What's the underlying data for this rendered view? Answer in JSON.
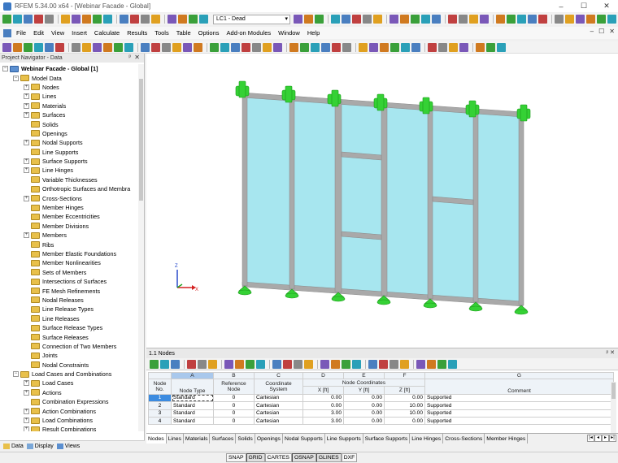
{
  "window": {
    "title": "RFEM 5.34.00 x64 - [Webinar Facade - Global]",
    "controls": [
      "–",
      "☐",
      "✕"
    ]
  },
  "load_case": {
    "selected": "LC1 - Dead"
  },
  "menu": {
    "items": [
      "File",
      "Edit",
      "View",
      "Insert",
      "Calculate",
      "Results",
      "Tools",
      "Table",
      "Options",
      "Add-on Modules",
      "Window",
      "Help"
    ],
    "mdi_controls": [
      "–",
      "☐",
      "✕"
    ]
  },
  "navigator": {
    "title": "Project Navigator - Data",
    "pin": "ᵖ",
    "close": "✕",
    "tree": [
      {
        "level": 0,
        "exp": "−",
        "label": "Webinar Facade - Global [1]",
        "bold": true,
        "icon": "blue"
      },
      {
        "level": 1,
        "exp": "−",
        "label": "Model Data"
      },
      {
        "level": 2,
        "exp": "+",
        "label": "Nodes"
      },
      {
        "level": 2,
        "exp": "+",
        "label": "Lines"
      },
      {
        "level": 2,
        "exp": "+",
        "label": "Materials"
      },
      {
        "level": 2,
        "exp": "+",
        "label": "Surfaces"
      },
      {
        "level": 2,
        "exp": "",
        "label": "Solids"
      },
      {
        "level": 2,
        "exp": "",
        "label": "Openings"
      },
      {
        "level": 2,
        "exp": "+",
        "label": "Nodal Supports"
      },
      {
        "level": 2,
        "exp": "",
        "label": "Line Supports"
      },
      {
        "level": 2,
        "exp": "+",
        "label": "Surface Supports"
      },
      {
        "level": 2,
        "exp": "+",
        "label": "Line Hinges"
      },
      {
        "level": 2,
        "exp": "",
        "label": "Variable Thicknesses"
      },
      {
        "level": 2,
        "exp": "",
        "label": "Orthotropic Surfaces and Membra"
      },
      {
        "level": 2,
        "exp": "+",
        "label": "Cross-Sections"
      },
      {
        "level": 2,
        "exp": "",
        "label": "Member Hinges"
      },
      {
        "level": 2,
        "exp": "",
        "label": "Member Eccentricities"
      },
      {
        "level": 2,
        "exp": "",
        "label": "Member Divisions"
      },
      {
        "level": 2,
        "exp": "+",
        "label": "Members"
      },
      {
        "level": 2,
        "exp": "",
        "label": "Ribs"
      },
      {
        "level": 2,
        "exp": "",
        "label": "Member Elastic Foundations"
      },
      {
        "level": 2,
        "exp": "",
        "label": "Member Nonlinearities"
      },
      {
        "level": 2,
        "exp": "",
        "label": "Sets of Members"
      },
      {
        "level": 2,
        "exp": "",
        "label": "Intersections of Surfaces"
      },
      {
        "level": 2,
        "exp": "",
        "label": "FE Mesh Refinements"
      },
      {
        "level": 2,
        "exp": "",
        "label": "Nodal Releases"
      },
      {
        "level": 2,
        "exp": "",
        "label": "Line Release Types"
      },
      {
        "level": 2,
        "exp": "",
        "label": "Line Releases"
      },
      {
        "level": 2,
        "exp": "",
        "label": "Surface Release Types"
      },
      {
        "level": 2,
        "exp": "",
        "label": "Surface Releases"
      },
      {
        "level": 2,
        "exp": "",
        "label": "Connection of Two Members"
      },
      {
        "level": 2,
        "exp": "",
        "label": "Joints"
      },
      {
        "level": 2,
        "exp": "",
        "label": "Nodal Constraints"
      },
      {
        "level": 1,
        "exp": "−",
        "label": "Load Cases and Combinations"
      },
      {
        "level": 2,
        "exp": "+",
        "label": "Load Cases"
      },
      {
        "level": 2,
        "exp": "+",
        "label": "Actions"
      },
      {
        "level": 2,
        "exp": "",
        "label": "Combination Expressions"
      },
      {
        "level": 2,
        "exp": "+",
        "label": "Action Combinations"
      },
      {
        "level": 2,
        "exp": "+",
        "label": "Load Combinations"
      },
      {
        "level": 2,
        "exp": "+",
        "label": "Result Combinations"
      }
    ],
    "tabs": [
      "Data",
      "Display",
      "Views"
    ]
  },
  "viewport": {
    "axis_labels": {
      "z": "Z",
      "x": "X"
    }
  },
  "table": {
    "title": "1.1 Nodes",
    "title_controls": "ᵖ ✕",
    "col_letters": [
      "A",
      "B",
      "C",
      "D",
      "E",
      "F",
      "G"
    ],
    "row_header": "Node No.",
    "headers": {
      "node_type": "Node Type",
      "ref_node": "Reference Node",
      "coord_sys": "Coordinate System",
      "coords_group": "Node Coordinates",
      "x": "X [ft]",
      "y": "Y [ft]",
      "z": "Z [ft]",
      "comment": "Comment"
    },
    "rows": [
      {
        "no": "1",
        "type": "Standard",
        "ref": "0",
        "sys": "Cartesian",
        "x": "0.00",
        "y": "0.00",
        "z": "0.00",
        "comment": "Supported"
      },
      {
        "no": "2",
        "type": "Standard",
        "ref": "0",
        "sys": "Cartesian",
        "x": "0.00",
        "y": "0.00",
        "z": "10.00",
        "comment": "Supported"
      },
      {
        "no": "3",
        "type": "Standard",
        "ref": "0",
        "sys": "Cartesian",
        "x": "3.00",
        "y": "0.00",
        "z": "10.00",
        "comment": "Supported"
      },
      {
        "no": "4",
        "type": "Standard",
        "ref": "0",
        "sys": "Cartesian",
        "x": "3.00",
        "y": "0.00",
        "z": "0.00",
        "comment": "Supported"
      }
    ],
    "sheet_tabs": [
      "Nodes",
      "Lines",
      "Materials",
      "Surfaces",
      "Solids",
      "Openings",
      "Nodal Supports",
      "Line Supports",
      "Surface Supports",
      "Line Hinges",
      "Cross-Sections",
      "Member Hinges"
    ],
    "sheet_nav": [
      "|◂",
      "◂",
      "▸",
      "▸|"
    ]
  },
  "statusbar": {
    "toggles": [
      "SNAP",
      "GRID",
      "CARTES",
      "OSNAP",
      "GLINES",
      "DXF"
    ]
  },
  "colors": {
    "surface": "#a7e6ef",
    "member": "#a9a9a9",
    "support": "#35d135",
    "accent": "#3b8be0"
  }
}
